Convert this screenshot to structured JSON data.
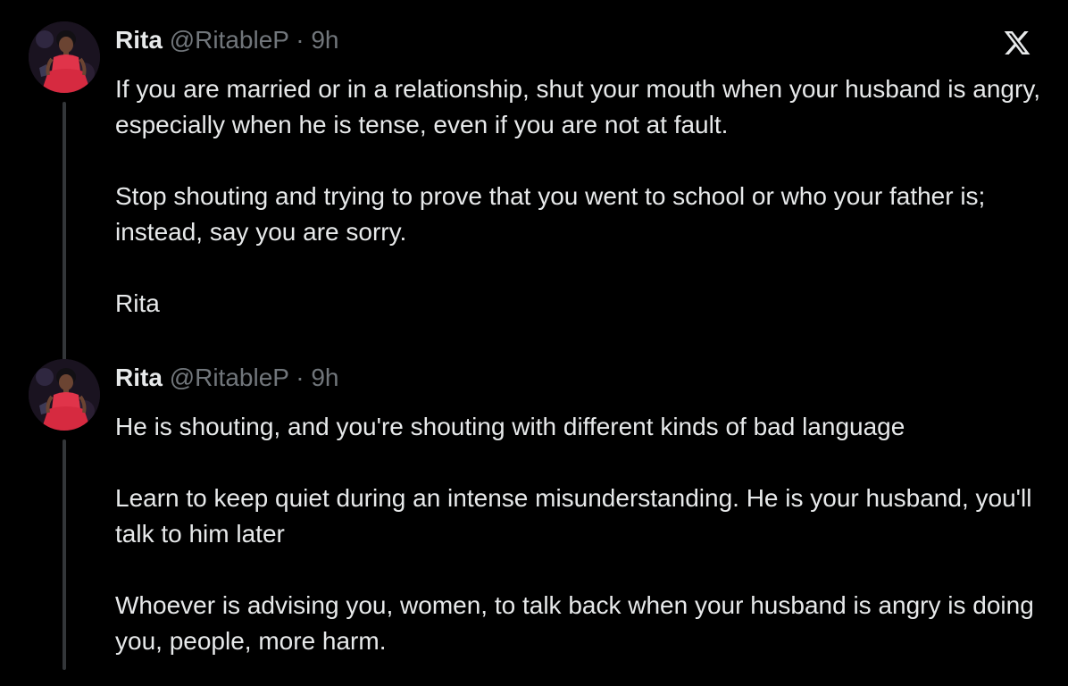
{
  "brand": {
    "logo_icon": "x-logo-icon",
    "background_color": "#000000",
    "text_color": "#e7e9ea",
    "muted_color": "#71767b",
    "thread_line_color": "#333639"
  },
  "tweets": [
    {
      "author": {
        "display_name": "Rita",
        "handle": "@RitableP",
        "avatar_icon": "avatar-icon"
      },
      "separator": "·",
      "time": "9h",
      "paragraphs": [
        "If you are married or in a relationship, shut your mouth when your husband is angry, especially when he is tense, even if you are not at fault.",
        "Stop shouting and trying to prove that you went to school or who your father is; instead, say you are sorry.",
        "Rita"
      ]
    },
    {
      "author": {
        "display_name": "Rita",
        "handle": "@RitableP",
        "avatar_icon": "avatar-icon"
      },
      "separator": "·",
      "time": "9h",
      "paragraphs": [
        "He is shouting, and you're shouting with different kinds of bad language",
        "Learn to keep quiet during an intense misunderstanding. He is your husband, you'll talk to him later",
        "Whoever is advising you, women, to talk back when your husband is angry is doing you, people, more harm."
      ]
    }
  ]
}
